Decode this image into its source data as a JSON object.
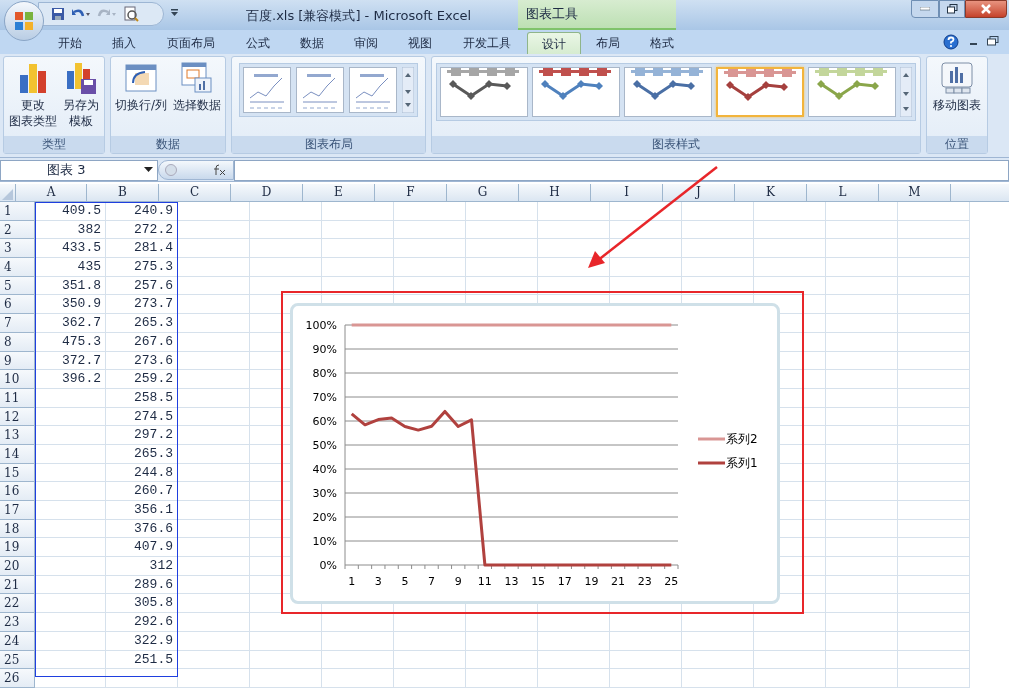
{
  "window": {
    "title": "百度.xls  [兼容模式] - Microsoft Excel",
    "context_title": "图表工具"
  },
  "tabs": [
    {
      "label": "开始",
      "selected": false
    },
    {
      "label": "插入",
      "selected": false
    },
    {
      "label": "页面布局",
      "selected": false
    },
    {
      "label": "公式",
      "selected": false
    },
    {
      "label": "数据",
      "selected": false
    },
    {
      "label": "审阅",
      "selected": false
    },
    {
      "label": "视图",
      "selected": false
    },
    {
      "label": "开发工具",
      "selected": false
    },
    {
      "label": "设计",
      "selected": true
    },
    {
      "label": "布局",
      "selected": false
    },
    {
      "label": "格式",
      "selected": false
    }
  ],
  "ribbon": [
    {
      "label": "类型",
      "kind": "buttons",
      "buttons": [
        {
          "lines": [
            "更改",
            "图表类型"
          ]
        },
        {
          "lines": [
            "另存为",
            "模板"
          ]
        }
      ]
    },
    {
      "label": "数据",
      "kind": "buttons",
      "buttons": [
        {
          "lines": [
            "切换行/列"
          ]
        },
        {
          "lines": [
            "选择数据"
          ]
        }
      ]
    },
    {
      "label": "图表布局",
      "kind": "layouts"
    },
    {
      "label": "图表样式",
      "kind": "styles",
      "styles": [
        {
          "color": "#595959",
          "selected": false
        },
        {
          "color": "#4f81bd",
          "selected": false
        },
        {
          "color": "#4a6fa5",
          "selected": false
        },
        {
          "color": "#a5403e",
          "selected": true
        },
        {
          "color": "#8aa64a",
          "selected": false
        }
      ]
    },
    {
      "label": "位置",
      "kind": "buttons",
      "buttons": [
        {
          "lines": [
            "移动图表"
          ]
        }
      ]
    }
  ],
  "name_box": "图表 3",
  "sheet": {
    "columns": [
      "A",
      "B",
      "C",
      "D",
      "E",
      "F",
      "G",
      "H",
      "I",
      "J",
      "K",
      "L",
      "M"
    ],
    "rows": [
      {
        "number": "1",
        "a": "409.5",
        "b": "240.9"
      },
      {
        "number": "2",
        "a": "382",
        "b": "272.2"
      },
      {
        "number": "3",
        "a": "433.5",
        "b": "281.4"
      },
      {
        "number": "4",
        "a": "435",
        "b": "275.3"
      },
      {
        "number": "5",
        "a": "351.8",
        "b": "257.6"
      },
      {
        "number": "6",
        "a": "350.9",
        "b": "273.7"
      },
      {
        "number": "7",
        "a": "362.7",
        "b": "265.3"
      },
      {
        "number": "8",
        "a": "475.3",
        "b": "267.6"
      },
      {
        "number": "9",
        "a": "372.7",
        "b": "273.6"
      },
      {
        "number": "10",
        "a": "396.2",
        "b": "259.2"
      },
      {
        "number": "11",
        "b": "258.5"
      },
      {
        "number": "12",
        "b": "274.5"
      },
      {
        "number": "13",
        "b": "297.2"
      },
      {
        "number": "14",
        "b": "265.3"
      },
      {
        "number": "15",
        "b": "244.8"
      },
      {
        "number": "16",
        "b": "260.7"
      },
      {
        "number": "17",
        "b": "356.1"
      },
      {
        "number": "18",
        "b": "376.6"
      },
      {
        "number": "19",
        "b": "407.9"
      },
      {
        "number": "20",
        "b": "312"
      },
      {
        "number": "21",
        "b": "289.6"
      },
      {
        "number": "22",
        "b": "305.8"
      },
      {
        "number": "23",
        "b": "292.6"
      },
      {
        "number": "24",
        "b": "322.9"
      },
      {
        "number": "25",
        "b": "251.5"
      },
      {
        "number": "26"
      }
    ]
  },
  "chart": {
    "chart_data": {
      "type": "line",
      "grid": true,
      "legend": "right",
      "x": [
        1,
        2,
        3,
        4,
        5,
        6,
        7,
        8,
        9,
        10,
        11,
        12,
        13,
        14,
        15,
        16,
        17,
        18,
        19,
        20,
        21,
        22,
        23,
        24,
        25
      ],
      "series": [
        {
          "name": "系列1",
          "color": "#b0413e",
          "values": [
            0.63,
            0.584,
            0.606,
            0.612,
            0.577,
            0.562,
            0.578,
            0.64,
            0.577,
            0.605,
            0,
            0,
            0,
            0,
            0,
            0,
            0,
            0,
            0,
            0,
            0,
            0,
            0,
            0,
            0
          ]
        },
        {
          "name": "系列2",
          "color": "#d99694",
          "values": [
            1,
            1,
            1,
            1,
            1,
            1,
            1,
            1,
            1,
            1,
            1,
            1,
            1,
            1,
            1,
            1,
            1,
            1,
            1,
            1,
            1,
            1,
            1,
            1,
            1
          ]
        }
      ],
      "xlim": [
        0.5,
        25.5
      ],
      "ylim": [
        0,
        1
      ],
      "xticks": [
        1,
        3,
        5,
        7,
        9,
        11,
        13,
        15,
        17,
        19,
        21,
        23,
        25
      ],
      "yticks": [
        {
          "value": 0,
          "label": "0%"
        },
        {
          "value": 0.1,
          "label": "10%"
        },
        {
          "value": 0.2,
          "label": "20%"
        },
        {
          "value": 0.3,
          "label": "30%"
        },
        {
          "value": 0.4,
          "label": "40%"
        },
        {
          "value": 0.5,
          "label": "50%"
        },
        {
          "value": 0.6,
          "label": "60%"
        },
        {
          "value": 0.7,
          "label": "70%"
        },
        {
          "value": 0.8,
          "label": "80%"
        },
        {
          "value": 0.9,
          "label": "90%"
        },
        {
          "value": 1,
          "label": "100%"
        }
      ]
    }
  }
}
